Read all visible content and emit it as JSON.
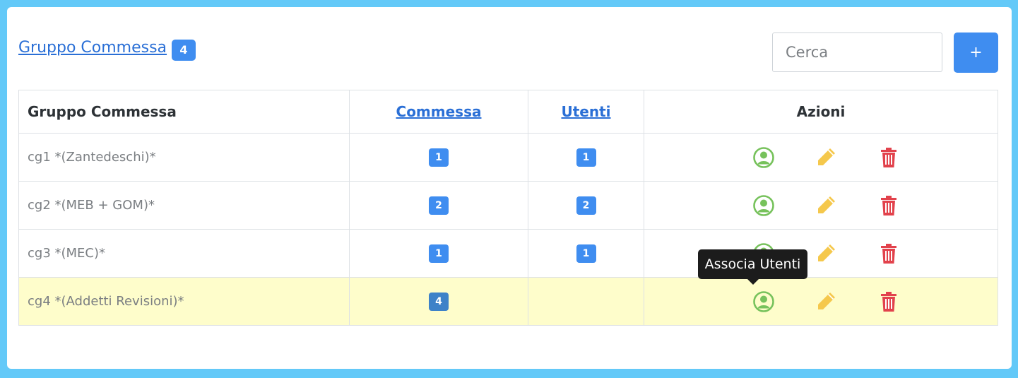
{
  "header": {
    "title": "Gruppo Commessa",
    "count_badge": "4"
  },
  "search": {
    "placeholder": "Cerca",
    "value": ""
  },
  "add_button_label": "+",
  "table": {
    "columns": [
      "Gruppo Commessa",
      "Commessa",
      "Utenti",
      "Azioni"
    ],
    "rows": [
      {
        "name": "cg1 *(Zantedeschi)*",
        "commessa": "1",
        "utenti": "1"
      },
      {
        "name": "cg2 *(MEB + GOM)*",
        "commessa": "2",
        "utenti": "2"
      },
      {
        "name": "cg3 *(MEC)*",
        "commessa": "1",
        "utenti": "1"
      },
      {
        "name": "cg4 *(Addetti Revisioni)*",
        "commessa": "4",
        "utenti": ""
      }
    ]
  },
  "tooltip": "Associa Utenti",
  "icons": {
    "associate_users": "user-circle-icon",
    "edit": "pencil-icon",
    "delete": "trash-icon"
  },
  "colors": {
    "accent": "#3f8df0",
    "link": "#2a6fd6",
    "user_icon": "#77c25c",
    "edit_icon": "#f5c84c",
    "delete_icon": "#e2424c",
    "highlight_row": "#fefdcb",
    "frame": "#63c9f8"
  }
}
